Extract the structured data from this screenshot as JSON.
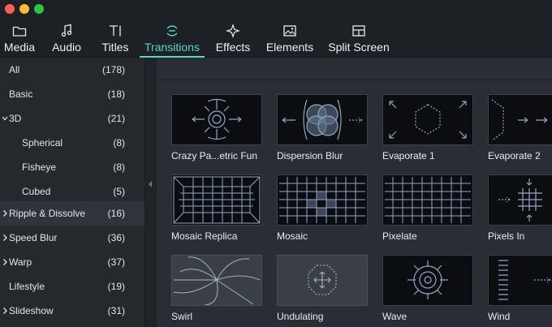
{
  "window": {
    "traffic_lights": [
      "close",
      "minimize",
      "zoom"
    ]
  },
  "tabs": [
    {
      "label": "Media",
      "icon": "folder-icon",
      "active": false
    },
    {
      "label": "Audio",
      "icon": "music-note-icon",
      "active": false
    },
    {
      "label": "Titles",
      "icon": "text-title-icon",
      "active": false
    },
    {
      "label": "Transitions",
      "icon": "transitions-icon",
      "active": true
    },
    {
      "label": "Effects",
      "icon": "sparkle-icon",
      "active": false
    },
    {
      "label": "Elements",
      "icon": "image-icon",
      "active": false
    },
    {
      "label": "Split Screen",
      "icon": "split-screen-icon",
      "active": false
    }
  ],
  "sidebar": {
    "items": [
      {
        "label": "All",
        "count": "(178)",
        "caret": "none",
        "indent": 0
      },
      {
        "label": "Basic",
        "count": "(18)",
        "caret": "none",
        "indent": 0
      },
      {
        "label": "3D",
        "count": "(21)",
        "caret": "down",
        "indent": 0
      },
      {
        "label": "Spherical",
        "count": "(8)",
        "caret": "none",
        "indent": 1
      },
      {
        "label": "Fisheye",
        "count": "(8)",
        "caret": "none",
        "indent": 1
      },
      {
        "label": "Cubed",
        "count": "(5)",
        "caret": "none",
        "indent": 1
      },
      {
        "label": "Ripple & Dissolve",
        "count": "(16)",
        "caret": "right",
        "indent": 0
      },
      {
        "label": "Speed Blur",
        "count": "(36)",
        "caret": "right",
        "indent": 0
      },
      {
        "label": "Warp",
        "count": "(37)",
        "caret": "right",
        "indent": 0
      },
      {
        "label": "Lifestyle",
        "count": "(19)",
        "caret": "none",
        "indent": 0
      },
      {
        "label": "Slideshow",
        "count": "(31)",
        "caret": "right",
        "indent": 0
      }
    ],
    "selected": "Ripple & Dissolve"
  },
  "transitions": [
    {
      "label": "Crazy Pa...etric Fun",
      "thumb": "radial-arrows"
    },
    {
      "label": "Dispersion Blur",
      "thumb": "overlapping-circles"
    },
    {
      "label": "Evaporate 1",
      "thumb": "hexagon-corners"
    },
    {
      "label": "Evaporate 2",
      "thumb": "chevrons-arrow"
    },
    {
      "label": "Mosaic Replica",
      "thumb": "perspective-grid"
    },
    {
      "label": "Mosaic",
      "thumb": "grid-with-tiles"
    },
    {
      "label": "Pixelate",
      "thumb": "flat-grid"
    },
    {
      "label": "Pixels In",
      "thumb": "arrows-into-grid"
    },
    {
      "label": "Swirl",
      "thumb": "swirl"
    },
    {
      "label": "Undulating",
      "thumb": "octagon-arrows"
    },
    {
      "label": "Wave",
      "thumb": "target-arrows"
    },
    {
      "label": "Wind",
      "thumb": "lines-arrow"
    }
  ],
  "colors": {
    "accent": "#52d8c8",
    "background": "#2a2d33",
    "sidebar": "#25282d",
    "toolbar": "#1d2024"
  }
}
